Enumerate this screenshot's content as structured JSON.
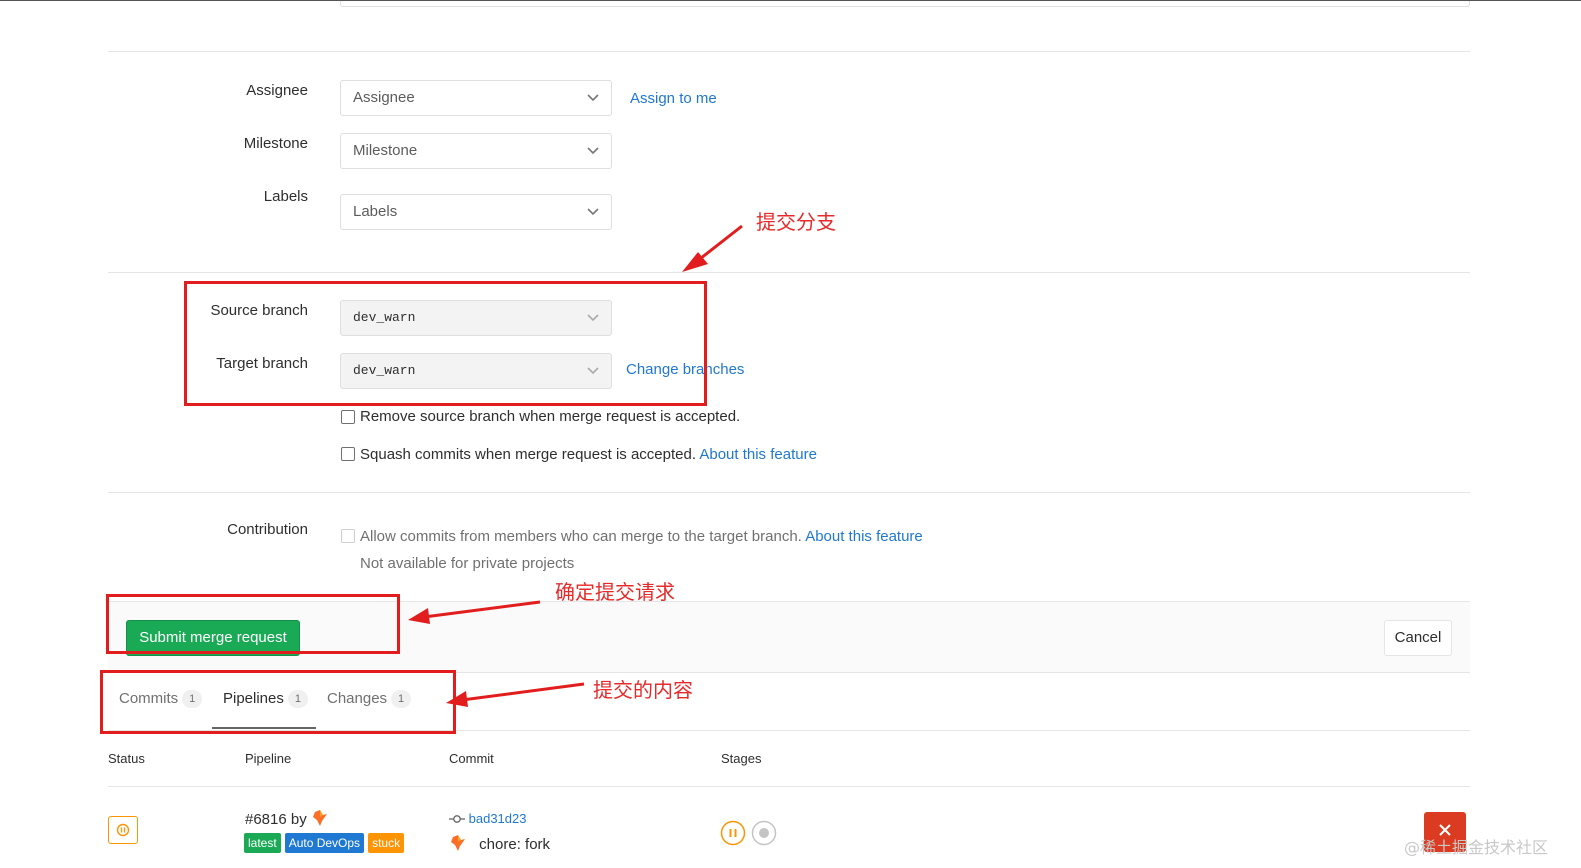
{
  "form": {
    "assignee": {
      "label": "Assignee",
      "placeholder": "Assignee",
      "assign_link": "Assign to me"
    },
    "milestone": {
      "label": "Milestone",
      "placeholder": "Milestone"
    },
    "labels": {
      "label": "Labels",
      "placeholder": "Labels"
    },
    "source_branch": {
      "label": "Source branch",
      "value": "dev_warn"
    },
    "target_branch": {
      "label": "Target branch",
      "value": "dev_warn",
      "change_link": "Change branches"
    },
    "remove_source": "Remove source branch when merge request is accepted.",
    "squash": {
      "text": "Squash commits when merge request is accepted.",
      "link": "About this feature"
    },
    "contribution": {
      "label": "Contribution",
      "text": "Allow commits from members who can merge to the target branch.",
      "link": "About this feature",
      "note": "Not available for private projects"
    }
  },
  "actions": {
    "submit": "Submit merge request",
    "cancel": "Cancel"
  },
  "tabs": [
    {
      "label": "Commits",
      "count": "1"
    },
    {
      "label": "Pipelines",
      "count": "1"
    },
    {
      "label": "Changes",
      "count": "1"
    }
  ],
  "table": {
    "headers": [
      "Status",
      "Pipeline",
      "Commit",
      "Stages"
    ],
    "row": {
      "pipeline_id": "#6816 by",
      "tags": [
        "latest",
        "Auto DevOps",
        "stuck"
      ],
      "commit_sha": "bad31d23",
      "commit_msg": "chore: fork"
    }
  },
  "annotations": {
    "submit_branch": "提交分支",
    "confirm_request": "确定提交请求",
    "submitted_content": "提交的内容",
    "watermark": "@稀土掘金技术社区"
  },
  "colors": {
    "green": "#1aaa55",
    "link": "#1f78d1",
    "annot_red": "#e21d1d",
    "tag_latest": "#1aaa55",
    "tag_devops": "#1f78d1",
    "tag_stuck": "#fc9403",
    "status_paused": "#fc9403"
  }
}
